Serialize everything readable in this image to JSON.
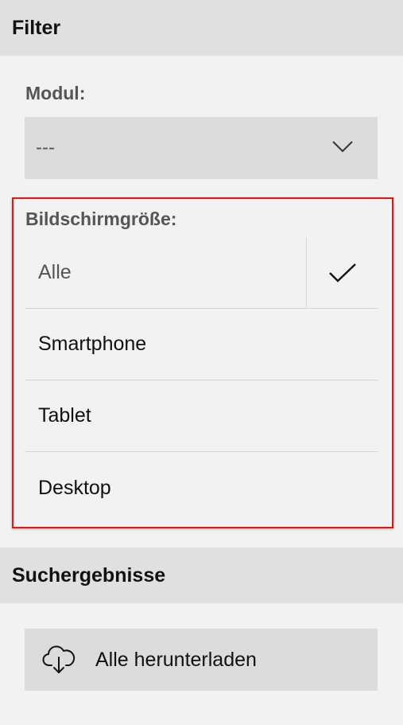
{
  "filter": {
    "title": "Filter",
    "modul": {
      "label": "Modul:",
      "value": "---",
      "icon": "chevron-down-icon"
    },
    "screen_size": {
      "label": "Bildschirmgröße:",
      "options": [
        {
          "label": "Alle",
          "selected": true
        },
        {
          "label": "Smartphone",
          "selected": false
        },
        {
          "label": "Tablet",
          "selected": false
        },
        {
          "label": "Desktop",
          "selected": false
        }
      ],
      "check_icon": "checkmark-icon"
    },
    "highlight_color": "#e3151a"
  },
  "results": {
    "title": "Suchergebnisse",
    "download_label": "Alle herunterladen",
    "download_icon": "cloud-download-icon"
  }
}
